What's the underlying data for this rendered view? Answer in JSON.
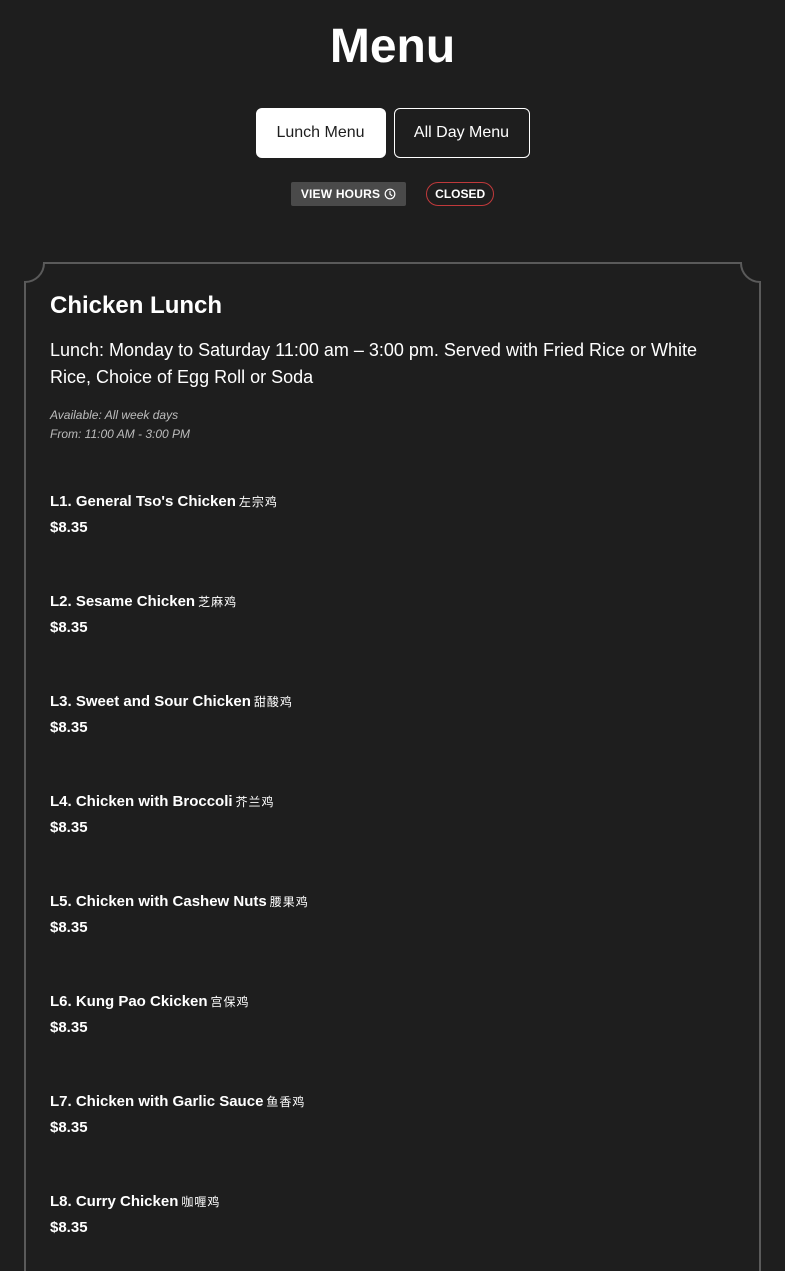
{
  "page": {
    "title": "Menu"
  },
  "tabs": [
    {
      "label": "Lunch Menu",
      "active": true
    },
    {
      "label": "All Day Menu",
      "active": false
    }
  ],
  "status": {
    "hours_label": "VIEW HOURS",
    "hours_icon": "clock-icon",
    "badge": "CLOSED",
    "badge_color": "#c0393b"
  },
  "section": {
    "title": "Chicken Lunch",
    "description": "Lunch: Monday to Saturday 11:00 am – 3:00 pm. Served with Fried Rice or White Rice, Choice of Egg Roll or Soda",
    "available": "Available: All week days",
    "from": "From: 11:00 AM - 3:00 PM"
  },
  "items": [
    {
      "name": "L1. General Tso's Chicken",
      "cjk": "左宗鸡",
      "price": "$8.35"
    },
    {
      "name": "L2. Sesame Chicken",
      "cjk": "芝麻鸡",
      "price": "$8.35"
    },
    {
      "name": "L3. Sweet and Sour Chicken",
      "cjk": "甜酸鸡",
      "price": "$8.35"
    },
    {
      "name": "L4. Chicken with Broccoli",
      "cjk": "芥兰鸡",
      "price": "$8.35"
    },
    {
      "name": "L5. Chicken with Cashew Nuts",
      "cjk": "腰果鸡",
      "price": "$8.35"
    },
    {
      "name": "L6. Kung Pao Ckicken",
      "cjk": "宫保鸡",
      "price": "$8.35"
    },
    {
      "name": "L7. Chicken with Garlic Sauce",
      "cjk": "鱼香鸡",
      "price": "$8.35"
    },
    {
      "name": "L8. Curry Chicken",
      "cjk": "咖喱鸡",
      "price": "$8.35"
    }
  ],
  "colors": {
    "background": "#1e1e1e",
    "text": "#ffffff",
    "muted": "#bdbdbd",
    "closed_border": "#c0393b",
    "hours_bg": "#4a4a4a"
  }
}
